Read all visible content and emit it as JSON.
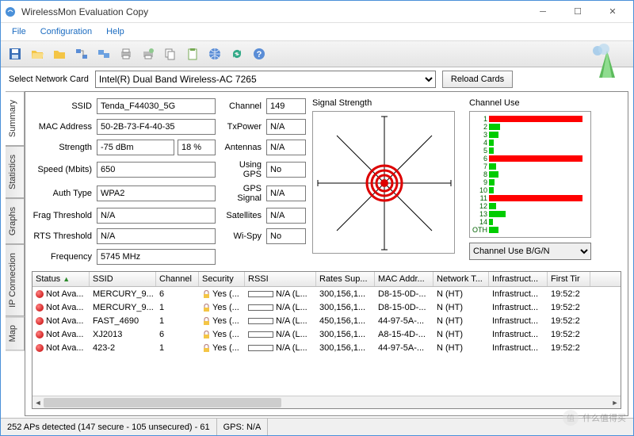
{
  "window": {
    "title": "WirelessMon Evaluation Copy"
  },
  "menu": {
    "file": "File",
    "config": "Configuration",
    "help": "Help"
  },
  "selector": {
    "label": "Select Network Card",
    "value": "Intel(R) Dual Band Wireless-AC 7265",
    "reload": "Reload Cards"
  },
  "tabs": {
    "summary": "Summary",
    "statistics": "Statistics",
    "graphs": "Graphs",
    "ipconn": "IP Connection",
    "map": "Map"
  },
  "fields": {
    "ssid_l": "SSID",
    "ssid": "Tenda_F44030_5G",
    "mac_l": "MAC Address",
    "mac": "50-2B-73-F4-40-35",
    "str_l": "Strength",
    "str": "-75 dBm",
    "str_pct": "18 %",
    "spd_l": "Speed (Mbits)",
    "spd": "650",
    "auth_l": "Auth Type",
    "auth": "WPA2",
    "frag_l": "Frag Threshold",
    "frag": "N/A",
    "rts_l": "RTS Threshold",
    "rts": "N/A",
    "freq_l": "Frequency",
    "freq": "5745 MHz",
    "chan_l": "Channel",
    "chan": "149",
    "txp_l": "TxPower",
    "txp": "N/A",
    "ant_l": "Antennas",
    "ant": "N/A",
    "gps_l": "Using GPS",
    "gps": "No",
    "gpss_l": "GPS Signal",
    "gpss": "N/A",
    "sat_l": "Satellites",
    "sat": "N/A",
    "wispy_l": "Wi-Spy",
    "wispy": "No"
  },
  "sig_hd": "Signal Strength",
  "ch_hd": "Channel Use",
  "ch_sel": "Channel Use B/G/N",
  "chart_data": {
    "type": "bar",
    "title": "Channel Use",
    "categories": [
      "1",
      "2",
      "3",
      "4",
      "5",
      "6",
      "7",
      "8",
      "9",
      "10",
      "11",
      "12",
      "13",
      "14",
      "OTH"
    ],
    "values": [
      100,
      12,
      10,
      5,
      5,
      100,
      8,
      10,
      6,
      5,
      100,
      8,
      18,
      4,
      10
    ],
    "colors": [
      "#f00",
      "#0c0",
      "#0c0",
      "#0c0",
      "#0c0",
      "#f00",
      "#0c0",
      "#0c0",
      "#0c0",
      "#0c0",
      "#f00",
      "#0c0",
      "#0c0",
      "#0c0",
      "#0c0"
    ]
  },
  "table": {
    "cols": [
      "Status",
      "SSID",
      "Channel",
      "Security",
      "RSSI",
      "Rates Sup...",
      "MAC Addr...",
      "Network T...",
      "Infrastruct...",
      "First Tir"
    ],
    "rows": [
      {
        "status": "Not Ava...",
        "ssid": "MERCURY_9...",
        "ch": "6",
        "sec": "Yes (...",
        "rssi": "N/A (L...",
        "rates": "300,156,1...",
        "mac": "D8-15-0D-...",
        "net": "N (HT)",
        "infra": "Infrastruct...",
        "time": "19:52:2"
      },
      {
        "status": "Not Ava...",
        "ssid": "MERCURY_9...",
        "ch": "1",
        "sec": "Yes (...",
        "rssi": "N/A (L...",
        "rates": "300,156,1...",
        "mac": "D8-15-0D-...",
        "net": "N (HT)",
        "infra": "Infrastruct...",
        "time": "19:52:2"
      },
      {
        "status": "Not Ava...",
        "ssid": "FAST_4690",
        "ch": "1",
        "sec": "Yes (...",
        "rssi": "N/A (L...",
        "rates": "450,156,1...",
        "mac": "44-97-5A-...",
        "net": "N (HT)",
        "infra": "Infrastruct...",
        "time": "19:52:2"
      },
      {
        "status": "Not Ava...",
        "ssid": "XJ2013",
        "ch": "6",
        "sec": "Yes (...",
        "rssi": "N/A (L...",
        "rates": "300,156,1...",
        "mac": "A8-15-4D-...",
        "net": "N (HT)",
        "infra": "Infrastruct...",
        "time": "19:52:2"
      },
      {
        "status": "Not Ava...",
        "ssid": "423-2",
        "ch": "1",
        "sec": "Yes (...",
        "rssi": "N/A (L...",
        "rates": "300,156,1...",
        "mac": "44-97-5A-...",
        "net": "N (HT)",
        "infra": "Infrastruct...",
        "time": "19:52:2"
      }
    ]
  },
  "status": {
    "aps": "252 APs detected (147 secure - 105 unsecured) - 61",
    "gps": "GPS: N/A"
  },
  "watermark": "什么值得买"
}
